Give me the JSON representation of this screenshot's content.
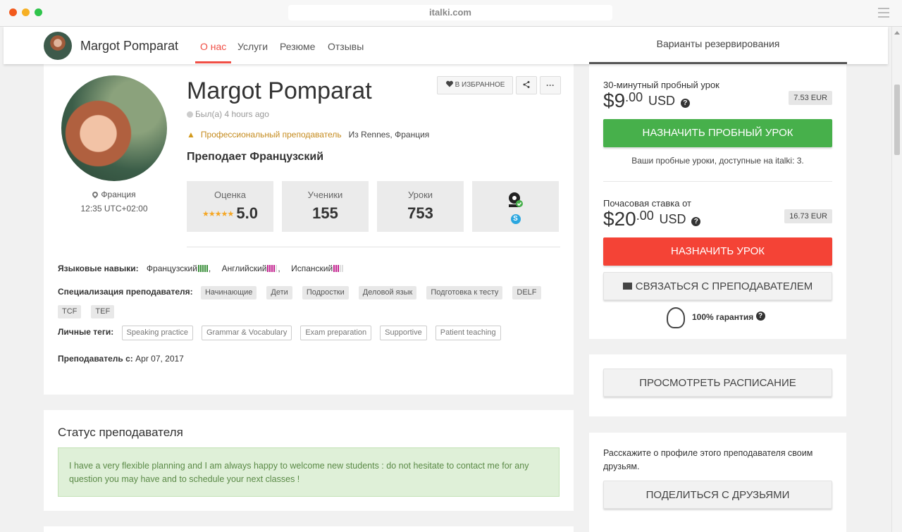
{
  "browser": {
    "url": "italki.com"
  },
  "header": {
    "teacher_name": "Margot Pomparat",
    "nav": [
      "О нас",
      "Услуги",
      "Резюме",
      "Отзывы"
    ],
    "booking_tab": "Варианты резервирования"
  },
  "profile": {
    "name": "Margot Pomparat",
    "last_seen": "Был(а) 4 hours ago",
    "pro_label": "Профессиональный преподаватель",
    "from": "Из Rennes, Франция",
    "teaches": "Преподает  Французский",
    "country": "Франция",
    "local_time": "12:35 UTC+02:00",
    "favorite_label": "В ИЗБРАННОЕ",
    "more_label": "···",
    "stats": [
      {
        "label": "Оценка",
        "value": "5.0",
        "stars": "★★★★★"
      },
      {
        "label": "Ученики",
        "value": "155"
      },
      {
        "label": "Уроки",
        "value": "753"
      }
    ],
    "languages_label": "Языковые навыки:",
    "languages": [
      {
        "name": "Французский",
        "level": 6
      },
      {
        "name": "Английский",
        "level": 5
      },
      {
        "name": "Испанский",
        "level": 4
      }
    ],
    "specialization_label": "Специализация преподавателя:",
    "specializations": [
      "Начинающие",
      "Дети",
      "Подростки",
      "Деловой язык",
      "Подготовка к тесту",
      "DELF",
      "TCF",
      "TEF"
    ],
    "tags_label": "Личные теги:",
    "tags": [
      "Speaking practice",
      "Grammar & Vocabulary",
      "Exam preparation",
      "Supportive",
      "Patient teaching"
    ],
    "since_label": "Преподаватель с:",
    "since_value": "Apr 07, 2017"
  },
  "status": {
    "title": "Статус преподавателя",
    "text": "I have a very flexible planning and I am always happy to welcome new students : do not hesitate to contact me for any question you may have and to schedule your next classes !"
  },
  "booking": {
    "trial_label": "30-минутный пробный урок",
    "trial_price_main": "$9",
    "trial_price_cents": ".00",
    "trial_currency": "USD",
    "trial_eur": "7.53 EUR",
    "trial_button": "НАЗНАЧИТЬ ПРОБНЫЙ УРОК",
    "trial_note": "Ваши пробные уроки, доступные на italki: 3.",
    "hourly_label": "Почасовая ставка от",
    "hourly_price_main": "$20",
    "hourly_price_cents": ".00",
    "hourly_currency": "USD",
    "hourly_eur": "16.73 EUR",
    "book_button": "НАЗНАЧИТЬ УРОК",
    "contact_button": "СВЯЗАТЬСЯ С ПРЕПОДАВАТЕЛЕМ",
    "guarantee": "100% гарантия"
  },
  "schedule": {
    "button": "ПРОСМОТРЕТЬ РАСПИСАНИЕ"
  },
  "share": {
    "text": "Расскажите о профиле этого преподавателя своим друзьям.",
    "button": "ПОДЕЛИТЬСЯ С ДРУЗЬЯМИ"
  },
  "colors": {
    "accent_red": "#f04e45",
    "green": "#47b04b",
    "red_button": "#f44336",
    "gold": "#c58b1e"
  }
}
